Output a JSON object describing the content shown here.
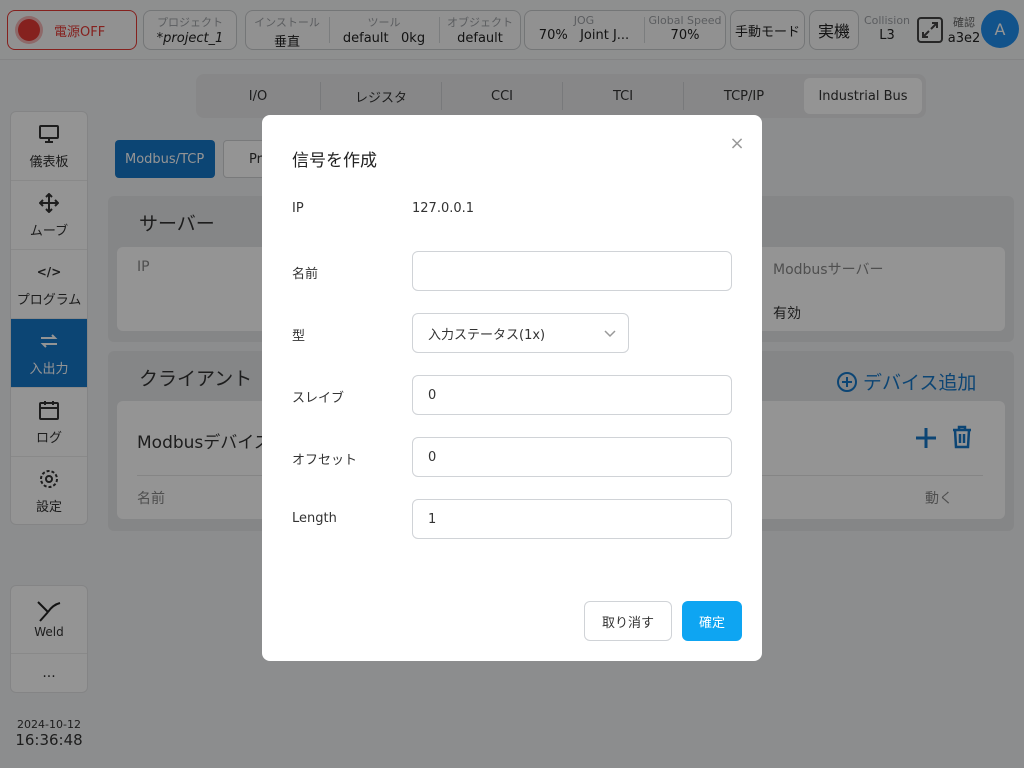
{
  "topbar": {
    "power_label": "電源OFF",
    "project": {
      "key": "プロジェクト",
      "value": "*project_1"
    },
    "install": {
      "key": "インストール",
      "value": "垂直"
    },
    "tool": {
      "key": "ツール",
      "value": "default   0kg"
    },
    "object": {
      "key": "オブジェクト",
      "value": "default"
    },
    "jog": {
      "key": "JOG",
      "value": "70%   Joint J..."
    },
    "speed": {
      "key": "Global Speed",
      "value": "70%"
    },
    "mode_label": "手動モード",
    "real_label": "実機",
    "collision": {
      "key": "Collision",
      "value": "L3"
    },
    "confirm": {
      "key": "確認",
      "value": "a3e2"
    },
    "avatar_letter": "A"
  },
  "sidebar": {
    "items": [
      {
        "label": "儀表板",
        "icon": "monitor-icon"
      },
      {
        "label": "ムーブ",
        "icon": "move-icon"
      },
      {
        "label": "プログラム",
        "icon": "code-icon"
      },
      {
        "label": "入出力",
        "icon": "io-icon"
      },
      {
        "label": "ログ",
        "icon": "calendar-icon"
      },
      {
        "label": "設定",
        "icon": "gear-icon"
      }
    ],
    "weld_label": "Weld",
    "more_label": "...",
    "date": "2024-10-12",
    "time": "16:36:48"
  },
  "main": {
    "tabs": [
      "I/O",
      "レジスタ",
      "CCI",
      "TCI",
      "TCP/IP",
      "Industrial Bus"
    ],
    "subtabs": [
      "Modbus/TCP",
      "Pr"
    ],
    "server_title": "サーバー",
    "server_ip_label": "IP",
    "server_modbus_label": "Modbusサーバー",
    "server_modbus_value": "有効",
    "client_title": "クライアント",
    "add_device_label": "デバイス追加",
    "device_label": "Modbusデバイス",
    "col_name": "名前",
    "col_action": "動く"
  },
  "dialog": {
    "title": "信号を作成",
    "ip_label": "IP",
    "ip_value": "127.0.0.1",
    "name_label": "名前",
    "name_value": "",
    "type_label": "型",
    "type_value": "入力ステータス(1x)",
    "slave_label": "スレイブ",
    "slave_value": "0",
    "offset_label": "オフセット",
    "offset_value": "0",
    "length_label": "Length",
    "length_value": "1",
    "cancel_label": "取り消す",
    "ok_label": "確定"
  },
  "colors": {
    "accent": "#1677c9",
    "confirm": "#0ea5f2",
    "power": "#e53935"
  }
}
